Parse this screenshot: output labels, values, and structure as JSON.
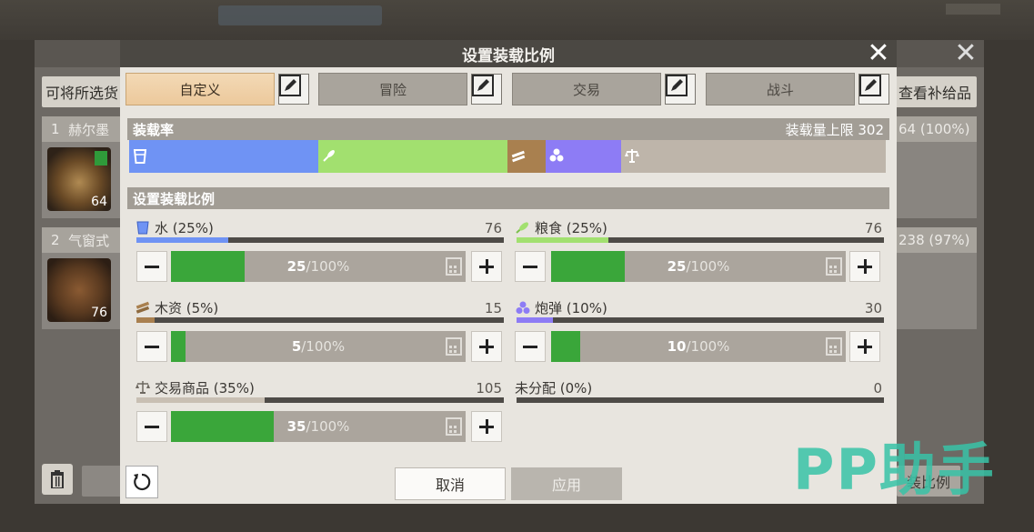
{
  "background": {
    "left_button": "可将所选货",
    "right_button": "查看补给品",
    "rows": [
      {
        "index": "1",
        "name": "赫尔墨",
        "count": "64",
        "right_text": "64 (100%)"
      },
      {
        "index": "2",
        "name": "气窗式",
        "count": "76",
        "right_text": "238 (97%)"
      }
    ],
    "bottom_right_text": "装比例"
  },
  "dialog": {
    "title": "设置装载比例",
    "tabs": [
      {
        "label": "自定义",
        "active": true
      },
      {
        "label": "冒险",
        "active": false
      },
      {
        "label": "交易",
        "active": false
      },
      {
        "label": "战斗",
        "active": false
      }
    ],
    "load_rate": {
      "header": "装载率",
      "capacity_label": "装载量上限 302",
      "segments": [
        {
          "name": "水",
          "percent": 25,
          "color": "#6f93f4",
          "icon": "bucket-icon"
        },
        {
          "name": "粮食",
          "percent": 25,
          "color": "#a2e06f",
          "icon": "grain-icon"
        },
        {
          "name": "木资",
          "percent": 5,
          "color": "#a9804f",
          "icon": "wood-icon"
        },
        {
          "name": "炮弹",
          "percent": 10,
          "color": "#8d7cf5",
          "icon": "cannonball-icon"
        },
        {
          "name": "交易商品",
          "percent": 35,
          "color": "#beb5aa",
          "icon": "scale-icon"
        }
      ]
    },
    "ratio_section": {
      "header": "设置装载比例"
    },
    "resources": [
      {
        "key": "water",
        "label": "水 (25%)",
        "amount": "76",
        "value": 25,
        "slider_num": "25",
        "slider_den": "/100%",
        "color": "#6f93f4",
        "icon": "bucket-icon"
      },
      {
        "key": "food",
        "label": "粮食 (25%)",
        "amount": "76",
        "value": 25,
        "slider_num": "25",
        "slider_den": "/100%",
        "color": "#a2e06f",
        "icon": "grain-icon"
      },
      {
        "key": "wood",
        "label": "木资 (5%)",
        "amount": "15",
        "value": 5,
        "slider_num": "5",
        "slider_den": "/100%",
        "color": "#a9804f",
        "icon": "wood-icon"
      },
      {
        "key": "shells",
        "label": "炮弹 (10%)",
        "amount": "30",
        "value": 10,
        "slider_num": "10",
        "slider_den": "/100%",
        "color": "#8d7cf5",
        "icon": "cannonball-icon"
      },
      {
        "key": "trade",
        "label": "交易商品 (35%)",
        "amount": "105",
        "value": 35,
        "slider_num": "35",
        "slider_den": "/100%",
        "color": "#c8bfb3",
        "icon": "scale-icon"
      },
      {
        "key": "unassigned",
        "label": "未分配 (0%)",
        "amount": "0",
        "value": 0,
        "color": "#4e4b47"
      }
    ],
    "buttons": {
      "cancel": "取消",
      "apply": "应用"
    }
  },
  "watermark": "PP助手"
}
